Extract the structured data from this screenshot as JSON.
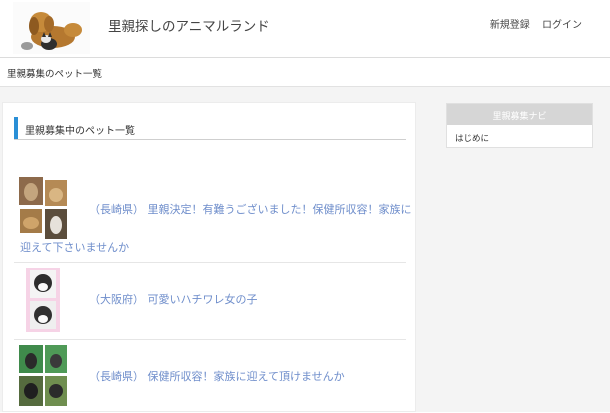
{
  "header": {
    "site_title": "里親探しのアニマルランド",
    "nav": {
      "register": "新規登録",
      "login": "ログイン"
    }
  },
  "breadcrumb": "里親募集のペット一覧",
  "main": {
    "section_title": "里親募集中のペット一覧",
    "pets": [
      {
        "line1": "（長崎県） 里親決定！有難うございました！保健所収容！家族に",
        "line2": "迎えて下さいませんか"
      },
      {
        "line1": "（大阪府） 可愛いハチワレ女の子"
      },
      {
        "line1": "（長崎県） 保健所収容！家族に迎えて頂けませんか"
      }
    ]
  },
  "sidebar": {
    "title": "里親募集ナビ",
    "items": [
      "はじめに"
    ]
  }
}
